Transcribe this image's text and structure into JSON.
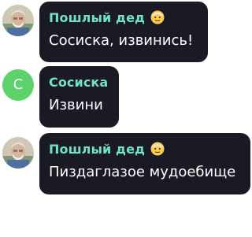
{
  "messages": [
    {
      "sender": "Пошлый дед",
      "sender_emoji": "old-man-emoji",
      "avatar": "photo",
      "text": "Сосиска, извинись!"
    },
    {
      "sender": "Сосиска",
      "avatar_letter": "С",
      "avatar_color": "#5bd36a",
      "text": "Извини"
    },
    {
      "sender": "Пошлый дед",
      "sender_emoji": "old-man-emoji",
      "avatar": "photo",
      "text": "Пиздаглазое мудоебище"
    }
  ],
  "colors": {
    "bubble_bg": "#1a1a24",
    "sender_name": "#6fe3c8",
    "message_text": "#ffffff"
  }
}
